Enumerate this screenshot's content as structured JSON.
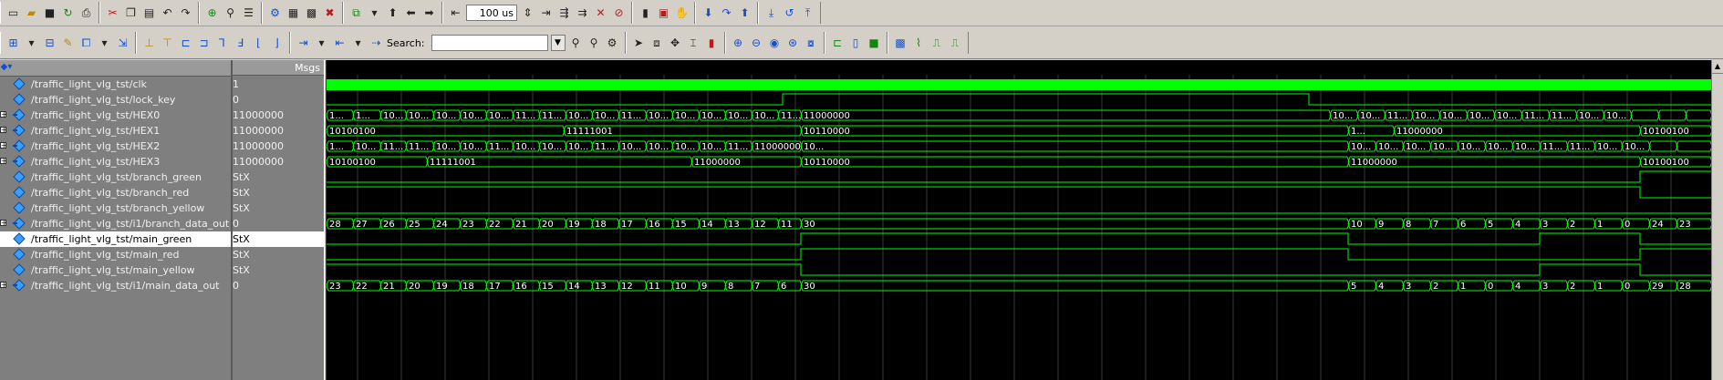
{
  "toolbar": {
    "sim_time_value": "100 us",
    "search_label": "Search:",
    "search_value": ""
  },
  "wave": {
    "msgs_header": "Msgs",
    "signals": [
      {
        "name": "/traffic_light_vlg_tst/clk",
        "value": "1",
        "type": "bit",
        "expandable": false
      },
      {
        "name": "/traffic_light_vlg_tst/lock_key",
        "value": "0",
        "type": "bit",
        "expandable": false
      },
      {
        "name": "/traffic_light_vlg_tst/HEX0",
        "value": "11000000",
        "type": "bus",
        "expandable": true
      },
      {
        "name": "/traffic_light_vlg_tst/HEX1",
        "value": "11000000",
        "type": "bus",
        "expandable": true
      },
      {
        "name": "/traffic_light_vlg_tst/HEX2",
        "value": "11000000",
        "type": "bus",
        "expandable": true
      },
      {
        "name": "/traffic_light_vlg_tst/HEX3",
        "value": "11000000",
        "type": "bus",
        "expandable": true
      },
      {
        "name": "/traffic_light_vlg_tst/branch_green",
        "value": "StX",
        "type": "bit",
        "expandable": false
      },
      {
        "name": "/traffic_light_vlg_tst/branch_red",
        "value": "StX",
        "type": "bit",
        "expandable": false
      },
      {
        "name": "/traffic_light_vlg_tst/branch_yellow",
        "value": "StX",
        "type": "bit",
        "expandable": false
      },
      {
        "name": "/traffic_light_vlg_tst/i1/branch_data_out",
        "value": "0",
        "type": "bus",
        "expandable": true
      },
      {
        "name": "/traffic_light_vlg_tst/main_green",
        "value": "StX",
        "type": "bit",
        "expandable": false,
        "selected": true
      },
      {
        "name": "/traffic_light_vlg_tst/main_red",
        "value": "StX",
        "type": "bit",
        "expandable": false
      },
      {
        "name": "/traffic_light_vlg_tst/main_yellow",
        "value": "StX",
        "type": "bit",
        "expandable": false
      },
      {
        "name": "/traffic_light_vlg_tst/i1/main_data_out",
        "value": "0",
        "type": "bus",
        "expandable": true
      }
    ],
    "bus_labels": {
      "HEX0": [
        "1...",
        "1...",
        "10...",
        "10...",
        "10...",
        "10...",
        "10...",
        "11...",
        "11...",
        "10...",
        "10...",
        "11...",
        "10...",
        "10...",
        "10...",
        "10...",
        "10...",
        "11...",
        "11000000",
        "10...",
        "10...",
        "11...",
        "10...",
        "10...",
        "10...",
        "10...",
        "11...",
        "11...",
        "10...",
        "10..."
      ],
      "HEX1": [
        "10100100",
        "11111001",
        "10110000",
        "1...",
        "11000000",
        "10100100"
      ],
      "HEX2": [
        "1...",
        "10...",
        "11...",
        "11...",
        "10...",
        "10...",
        "11...",
        "10...",
        "10...",
        "10...",
        "11...",
        "10...",
        "10...",
        "10...",
        "10...",
        "11...",
        "11000000",
        "10...",
        "10...",
        "10...",
        "10...",
        "10...",
        "10...",
        "10...",
        "10...",
        "11...",
        "11...",
        "10...",
        "10..."
      ],
      "HEX3": [
        "10100100",
        "11111001",
        "11000000",
        "10110000",
        "11000000",
        "10100100"
      ],
      "branch_data_out": [
        "28",
        "27",
        "26",
        "25",
        "24",
        "23",
        "22",
        "21",
        "20",
        "19",
        "18",
        "17",
        "16",
        "15",
        "14",
        "13",
        "12",
        "11",
        "30",
        "10",
        "9",
        "8",
        "7",
        "6",
        "5",
        "4",
        "3",
        "2",
        "1",
        "0",
        "24",
        "23"
      ],
      "main_data_out": [
        "23",
        "22",
        "21",
        "20",
        "19",
        "18",
        "17",
        "16",
        "15",
        "14",
        "13",
        "12",
        "11",
        "10",
        "9",
        "8",
        "7",
        "6",
        "30",
        "5",
        "4",
        "3",
        "2",
        "1",
        "0",
        "4",
        "3",
        "2",
        "1",
        "0",
        "29",
        "28"
      ]
    },
    "colors": {
      "waveform": "#00ff00",
      "background": "#000000",
      "grid": "#3a3a3a",
      "label": "#ffffff",
      "pane": "#7f7f7f"
    }
  }
}
